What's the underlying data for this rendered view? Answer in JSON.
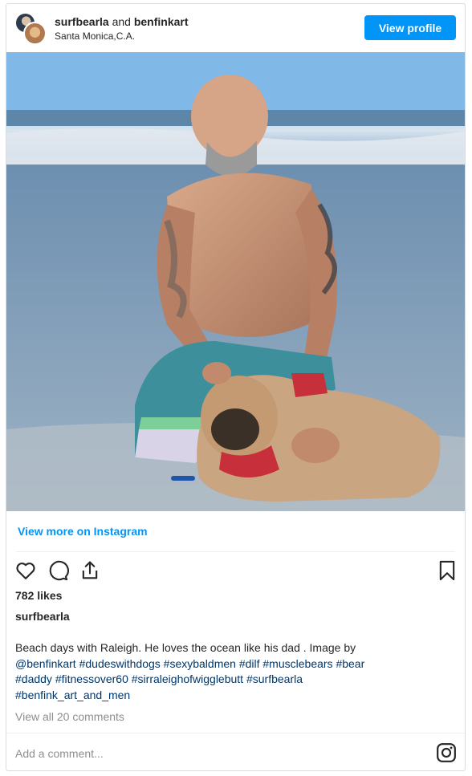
{
  "header": {
    "user1": "surfbearla",
    "joiner": "and",
    "user2": "benfinkart",
    "location": "Santa Monica,C.A.",
    "view_profile_label": "View profile"
  },
  "photo": {
    "icon": "beach-photo"
  },
  "view_more_label": "View more on Instagram",
  "actions": {
    "like_icon": "heart-icon",
    "comment_icon": "comment-icon",
    "share_icon": "share-icon",
    "save_icon": "bookmark-icon"
  },
  "likes": "782 likes",
  "owner": "surfbearla",
  "caption": {
    "text": "Beach days with Raleigh. He loves the ocean like his dad . Image by",
    "tags_line1": "@benfinkart #dudeswithdogs #sexybaldmen #dilf #musclebears #bear",
    "tags_line2": "#daddy #fitnessover60 #sirraleighofwigglebutt #surfbearla",
    "tags_line3": "#benfink_art_and_men"
  },
  "comments_link": "View all 20 comments",
  "add_comment_placeholder": "Add a comment...",
  "colors": {
    "accent": "#0095f6",
    "hashtag": "#00376b",
    "muted": "#8e8e8e"
  }
}
